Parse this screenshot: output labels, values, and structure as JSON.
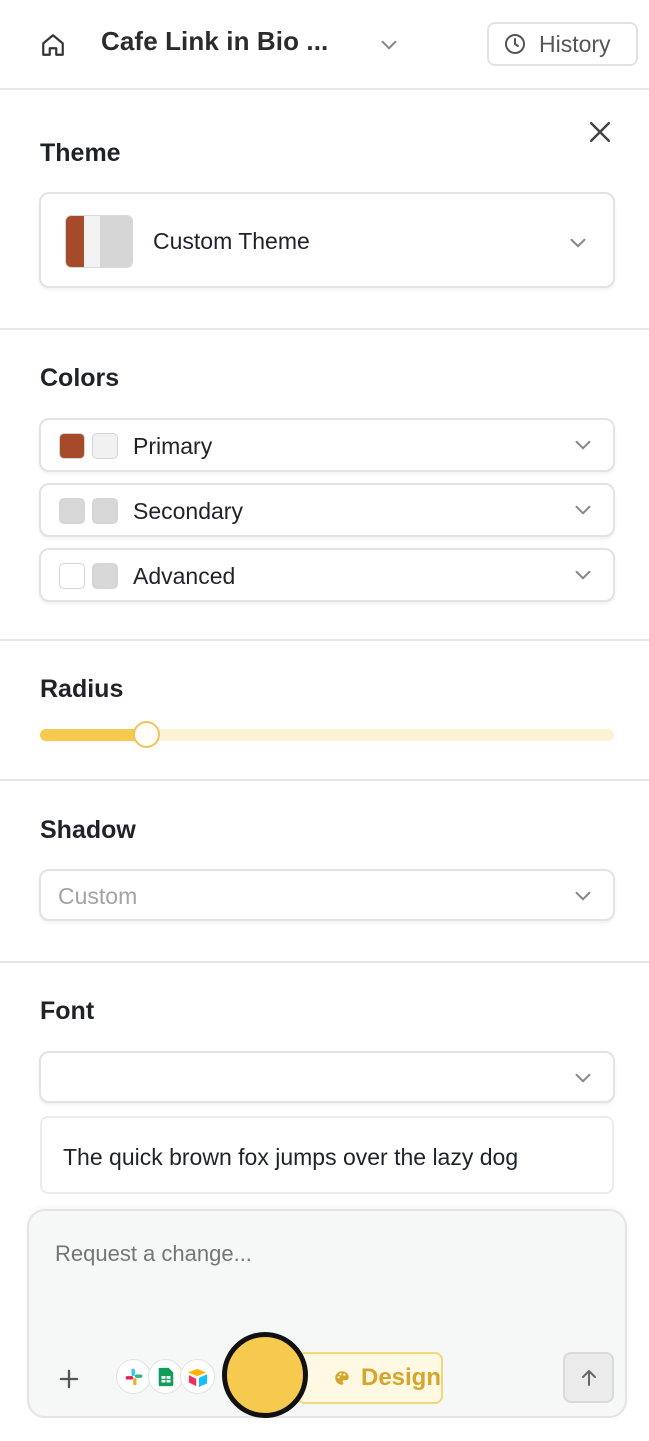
{
  "header": {
    "project_title": "Cafe Link in Bio ...",
    "history_label": "History"
  },
  "theme": {
    "title": "Theme",
    "selected": "Custom Theme",
    "swatch_colors": [
      "#a64b2a",
      "#f3f3f3",
      "#d6d6d6"
    ]
  },
  "colors": {
    "title": "Colors",
    "rows": [
      {
        "label": "Primary",
        "swatches": [
          "#a64b2a",
          "#f1f1f1"
        ]
      },
      {
        "label": "Secondary",
        "swatches": [
          "#d7d7d7",
          "#d7d7d7"
        ]
      },
      {
        "label": "Advanced",
        "swatches": [
          "#ffffff",
          "#d7d7d7"
        ]
      }
    ]
  },
  "radius": {
    "title": "Radius",
    "value_fraction": 0.185,
    "track_color": "#fcf3d6",
    "fill_color": "#f6c94f"
  },
  "shadow": {
    "title": "Shadow",
    "selected": "Custom"
  },
  "font": {
    "title": "Font",
    "selected": "",
    "preview_text": "The quick brown fox jumps over the lazy dog"
  },
  "composer": {
    "placeholder": "Request a change...",
    "integrations": [
      "slack-icon",
      "google-sheets-icon",
      "airtable-icon"
    ],
    "mode_label": "Design"
  },
  "accent_color": "#f6c94f"
}
